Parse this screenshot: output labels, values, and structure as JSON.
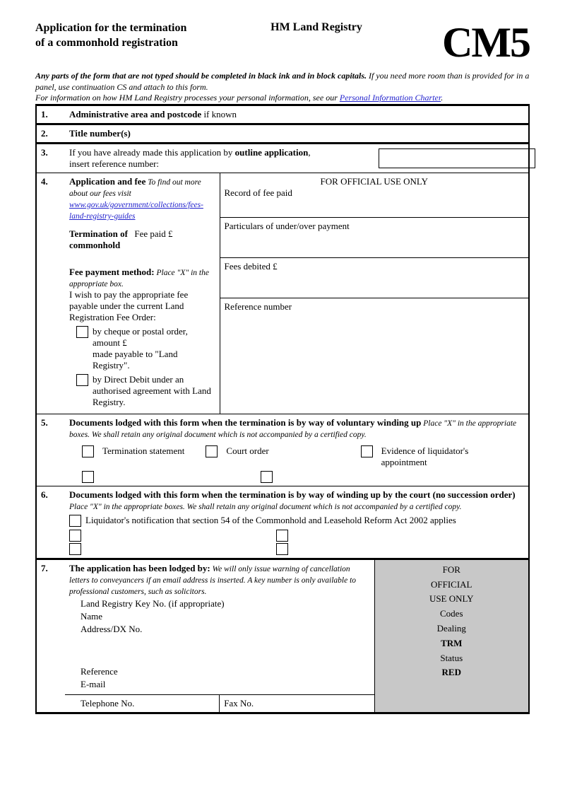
{
  "header": {
    "title": "Application for the termination of a commonhold registration",
    "registry": "HM Land Registry",
    "form_code": "CM5"
  },
  "intro": {
    "bold": "Any parts of the form that are not typed should be completed in black ink and in block capitals.",
    "rest": " If you need more room than is provided for in a panel, use continuation CS and attach to this form.",
    "privacy_prefix": "For information on how HM Land Registry processes your personal information, see our ",
    "privacy_link": "Personal Information Charter",
    "privacy_suffix": "."
  },
  "panels": {
    "p1": {
      "num": "1.",
      "label_bold": "Administrative area and postcode",
      "label_rest": " if known"
    },
    "p2": {
      "num": "2.",
      "label_bold": "Title number(s)"
    },
    "p3": {
      "num": "3.",
      "line1a": "If you have already made this application by ",
      "line1b": "outline application",
      "line1c": ",",
      "line2": "insert reference number:"
    },
    "p4": {
      "num": "4.",
      "app_fee_bold": "Application and fee",
      "app_fee_note": " To find out more about our fees visit",
      "fees_link": "www.gov.uk/government/collections/fees-land-registry-guides",
      "termination_label": "Termination of commonhold",
      "fee_paid_label": "Fee paid £",
      "method_bold": "Fee payment method:",
      "method_note": " Place \"X\" in the appropriate box.",
      "method_intro": "I wish to pay the appropriate fee payable under the current Land Registration Fee Order:",
      "opt1a": "by cheque or postal order, amount £",
      "opt1b": "made payable to \"Land Registry\".",
      "opt2": "by Direct Debit under an authorised agreement with Land Registry.",
      "official_title": "FOR OFFICIAL USE ONLY",
      "record_fee": "Record of fee paid",
      "particulars": "Particulars of under/over payment",
      "fees_debited": "Fees debited £",
      "ref_num": "Reference number"
    },
    "p5": {
      "num": "5.",
      "title_bold": "Documents lodged with this form when the termination is by way of voluntary winding up",
      "note": " Place \"X\" in the appropriate boxes. We shall retain any original document which is not accompanied by a certified copy.",
      "doc1": "Termination statement",
      "doc2": "Court order",
      "doc3": "Evidence of liquidator's appointment"
    },
    "p6": {
      "num": "6.",
      "title_bold": "Documents lodged with this form when the termination is by way of winding up by the court (no succession order)",
      "note": " Place \"X\" in the appropriate boxes. We shall retain any original document which is not accompanied by a certified copy.",
      "doc1": "Liquidator's notification that section 54 of the Commonhold and Leasehold Reform Act 2002 applies"
    },
    "p7": {
      "num": "7.",
      "title_bold": "The application has been lodged by:",
      "note": " We will only issue warning of cancellation letters to conveyancers if an email address is inserted. A key number is only available to professional customers, such as solicitors.",
      "key_no": "Land Registry Key No. (if appropriate)",
      "name": "Name",
      "address": "Address/DX No.",
      "reference": "Reference",
      "email": "E-mail",
      "telephone": "Telephone No.",
      "fax": "Fax No.",
      "official": {
        "title1": "FOR",
        "title2": "OFFICIAL",
        "title3": "USE ONLY",
        "codes": "Codes",
        "dealing": "Dealing",
        "trm": "TRM",
        "status": "Status",
        "red": "RED"
      }
    }
  }
}
